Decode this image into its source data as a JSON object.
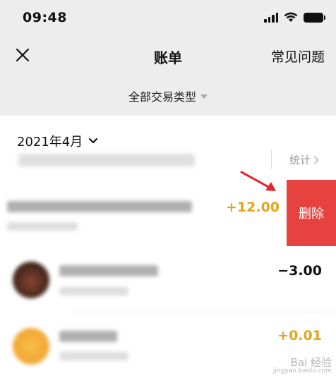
{
  "status_bar": {
    "time": "09:48"
  },
  "nav": {
    "title": "账单",
    "faq_label": "常见问题"
  },
  "filter": {
    "label": "全部交易类型"
  },
  "month": {
    "label": "2021年4月"
  },
  "stats": {
    "label": "统计"
  },
  "transactions": [
    {
      "amount": "+12.00",
      "amount_color": "#e3a51a",
      "delete_label": "删除"
    },
    {
      "amount": "−3.00",
      "amount_color": "#111111"
    },
    {
      "amount": "+0.01",
      "amount_color": "#e3a51a"
    }
  ],
  "colors": {
    "header_bg": "#ededed",
    "delete_red": "#e64340",
    "income_gold": "#e3a51a",
    "annotation_arrow": "#e3242b"
  },
  "watermark": {
    "main": "Bai 经验",
    "sub": "jingyan.baidu.com"
  }
}
